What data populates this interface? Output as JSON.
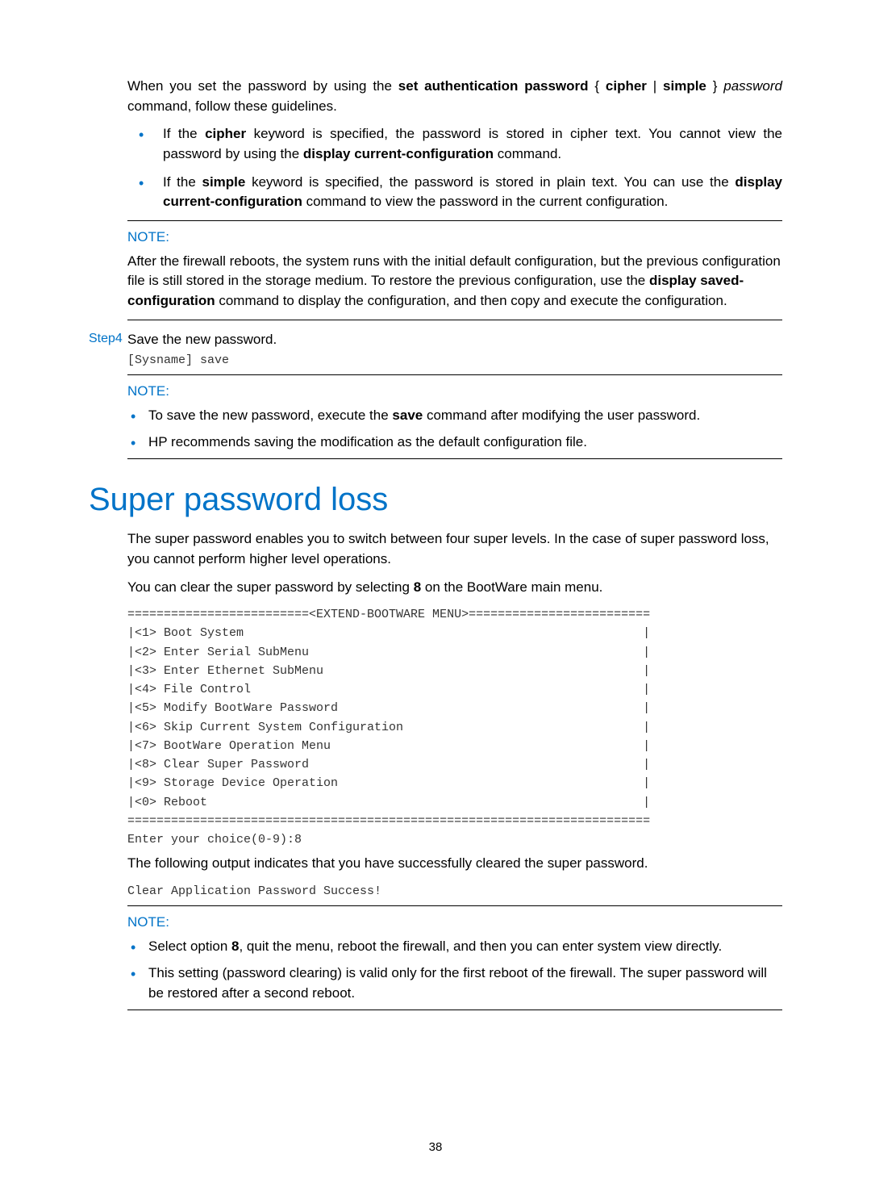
{
  "intro_para_parts": {
    "before_cmd": "When you set the password by using the ",
    "cmd": "set authentication password",
    "brace_open": " { ",
    "opt1": "cipher",
    "pipe": " | ",
    "opt2": "simple",
    "brace_close": " } ",
    "arg": "password",
    "after": " command, follow these guidelines."
  },
  "main_bullet_1": {
    "a": "If the ",
    "b": "cipher",
    "c": " keyword is specified, the password is stored in cipher text. You cannot view the password by using the ",
    "d": "display current-configuration",
    "e": " command."
  },
  "main_bullet_2": {
    "a": "If the ",
    "b": "simple",
    "c": " keyword is specified, the password is stored in plain text. You can use the ",
    "d": "display current-configuration",
    "e": " command to view the password in the current configuration."
  },
  "note_label": "NOTE:",
  "note1": {
    "a": "After the firewall reboots, the system runs with the initial default configuration, but the previous configuration file is still stored in the storage medium. To restore the previous configuration, use the ",
    "b": "display saved-configuration",
    "c": " command to display the configuration, and then copy and execute the configuration."
  },
  "step4_label": "Step4",
  "step4_text": "Save the new password.",
  "step4_code": "[Sysname] save",
  "note2_b1": {
    "a": "To save the new password, execute the ",
    "b": "save",
    "c": " command after modifying the user password."
  },
  "note2_b2": "HP recommends saving the modification as the default configuration file.",
  "heading": "Super password loss",
  "super_para1": "The super password enables you to switch between four super levels. In the case of super password loss, you cannot perform higher level operations.",
  "super_para2": {
    "a": "You can clear the super password by selecting ",
    "b": "8",
    "c": " on the BootWare main menu."
  },
  "menu_code": "=========================<EXTEND-BOOTWARE MENU>=========================\n|<1> Boot System                                                       |\n|<2> Enter Serial SubMenu                                              |\n|<3> Enter Ethernet SubMenu                                            |\n|<4> File Control                                                      |\n|<5> Modify BootWare Password                                          |\n|<6> Skip Current System Configuration                                 |\n|<7> BootWare Operation Menu                                           |\n|<8> Clear Super Password                                              |\n|<9> Storage Device Operation                                          |\n|<0> Reboot                                                            |\n========================================================================\nEnter your choice(0-9):8",
  "clear_para": "The following output indicates that you have successfully cleared the super password.",
  "clear_code": "Clear Application Password Success!",
  "note3_b1": {
    "a": "Select option ",
    "b": "8",
    "c": ", quit the menu, reboot the firewall, and then you can enter system view directly."
  },
  "note3_b2": "This setting (password clearing) is valid only for the first reboot of the firewall. The super password will be restored after a second reboot.",
  "page_number": "38"
}
